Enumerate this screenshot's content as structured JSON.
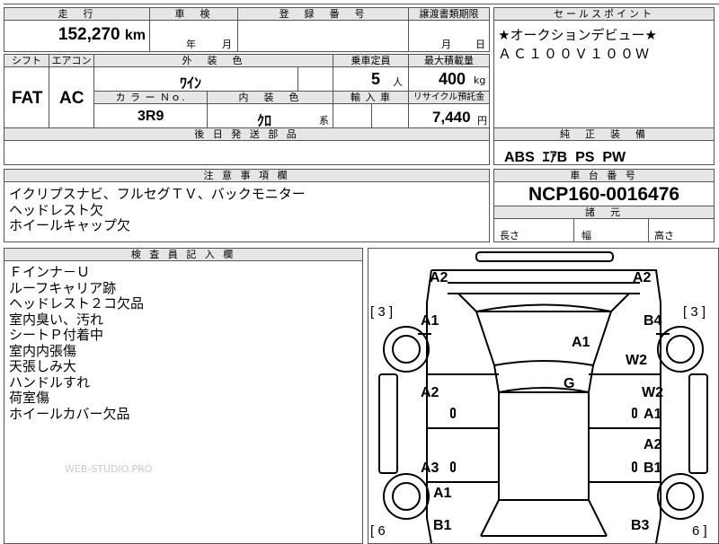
{
  "top_cut": {
    "text": "車検"
  },
  "mileage": {
    "header": "走　行",
    "value": "152,270",
    "unit": "km"
  },
  "inspection": {
    "header": "車　検",
    "year": "年",
    "month": "月"
  },
  "registration": {
    "header": "登　録　番　号"
  },
  "transfer": {
    "header": "譲渡書類期限",
    "month": "月",
    "day": "日"
  },
  "sales_point": {
    "header": "セールスポイント",
    "line1": "★オークションデビュー★",
    "line2": "ＡＣ１００Ｖ１００Ｗ"
  },
  "shift": {
    "header": "シフト",
    "value": "FAT"
  },
  "aircon": {
    "header": "エアコン",
    "value": "AC"
  },
  "exterior_color": {
    "header": "外　装　色",
    "value": "ﾜｲﾝ"
  },
  "capacity": {
    "header": "乗車定員",
    "value": "5",
    "unit": "人"
  },
  "max_load": {
    "header": "最大積載量",
    "value": "400",
    "unit": "kg"
  },
  "color_no": {
    "header": "カ ラ ー Ｎｏ.",
    "value": "3R9"
  },
  "interior_color": {
    "header": "内　装　色",
    "value": "ｸﾛ",
    "suffix": "系"
  },
  "import": {
    "header": "輸 入 車"
  },
  "recycle": {
    "header": "リサイクル預託金",
    "value": "7,440",
    "unit": "円"
  },
  "later_parts": {
    "header": "後 日 発 送 部 品"
  },
  "genuine": {
    "header": "純　正　装　備",
    "value": "ABS  ｴｱB  PS  PW"
  },
  "caution": {
    "header": "注 意 事 項 欄",
    "lines": [
      "イクリプスナビ、フルセグＴＶ、バックモニター",
      "ヘッドレスト欠",
      "ホイールキャップ欠"
    ]
  },
  "chassis": {
    "header": "車 台 番 号",
    "value": "NCP160-0016476"
  },
  "dimensions": {
    "header": "諸　元",
    "length": "長さ",
    "width": "幅",
    "height": "高さ"
  },
  "inspector": {
    "header": "検 査 員 記 入 欄",
    "lines": [
      "Ｆインナ－Ｕ",
      "ルーフキャリア跡",
      "ヘッドレスト２コ欠品",
      "室内臭い、汚れ",
      "シートＰ付着中",
      "室内内張傷",
      "天張しみ大",
      "ハンドルすれ",
      "荷室傷",
      "ホイールカバー欠品"
    ]
  },
  "watermark": "WEB-STUDIO.PRO",
  "diagram": {
    "bracket_3_left": "[ 3 ]",
    "bracket_3_right": "[ 3 ]",
    "bracket_6_left": "[ 6",
    "bracket_6_right": "6 ]",
    "marks": [
      "A2",
      "A2",
      "A1",
      "B4",
      "A1",
      "W2",
      "A2",
      "G",
      "W2",
      "A1",
      "A2",
      "A3",
      "B1",
      "A1",
      "B1",
      "B3"
    ]
  }
}
